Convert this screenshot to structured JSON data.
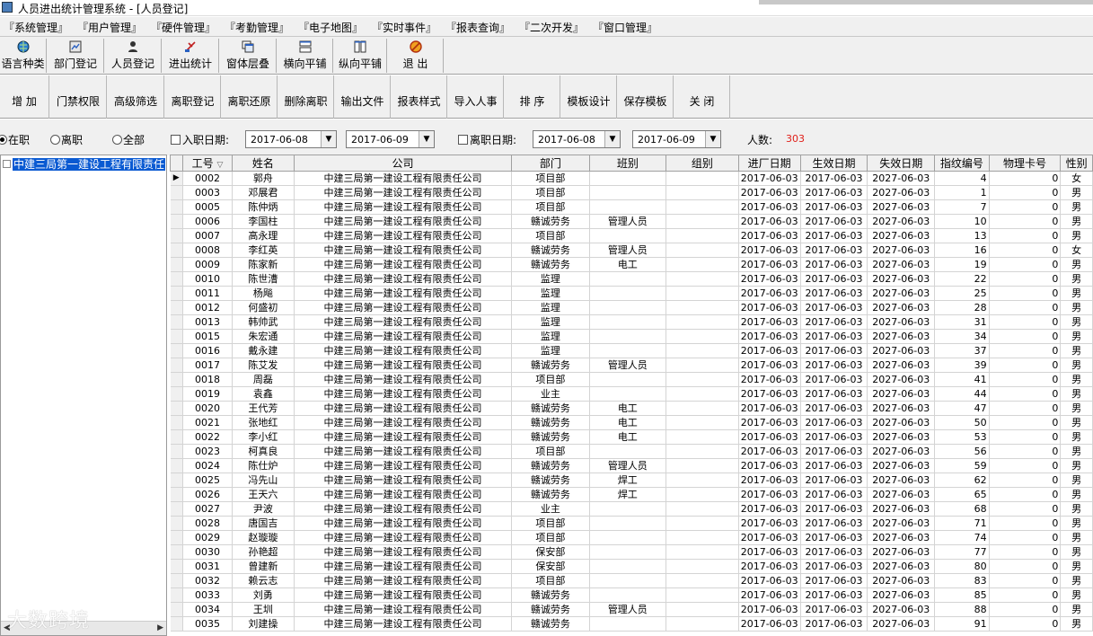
{
  "window": {
    "title": "人员进出统计管理系统 - [人员登记]"
  },
  "menu": [
    "『系统管理』",
    "『用户管理』",
    "『硬件管理』",
    "『考勤管理』",
    "『电子地图』",
    "『实时事件』",
    "『报表查询』",
    "『二次开发』",
    "『窗口管理』"
  ],
  "toolbar1": [
    {
      "label": "语言种类",
      "icon": "globe-icon"
    },
    {
      "label": "部门登记",
      "icon": "department-icon"
    },
    {
      "label": "人员登记",
      "icon": "person-icon"
    },
    {
      "label": "进出统计",
      "icon": "statistics-icon"
    },
    {
      "label": "窗体层叠",
      "icon": "cascade-windows-icon"
    },
    {
      "label": "横向平铺",
      "icon": "tile-horizontal-icon"
    },
    {
      "label": "纵向平铺",
      "icon": "tile-vertical-icon"
    },
    {
      "label": "退 出",
      "icon": "exit-icon"
    }
  ],
  "toolbar2": [
    "增  加",
    "门禁权限",
    "高级筛选",
    "离职登记",
    "离职还原",
    "删除离职",
    "输出文件",
    "报表样式",
    "导入人事",
    "排  序",
    "模板设计",
    "保存模板",
    "关  闭"
  ],
  "filter": {
    "radios": [
      {
        "label": "在职",
        "selected": true
      },
      {
        "label": "离职",
        "selected": false
      },
      {
        "label": "全部",
        "selected": false
      }
    ],
    "hire_date_label": "入职日期:",
    "hire_from": "2017-06-08",
    "hire_to": "2017-06-09",
    "leave_date_label": "离职日期:",
    "leave_from": "2017-06-08",
    "leave_to": "2017-06-09",
    "count_label": "人数:",
    "count_value": "303",
    "count_color": "#e0201a"
  },
  "tree": {
    "root_label": "中建三局第一建设工程有限责任"
  },
  "watermark": "大数跨境",
  "grid": {
    "columns": [
      "工号",
      "姓名",
      "公司",
      "部门",
      "班别",
      "组别",
      "进厂日期",
      "生效日期",
      "失效日期",
      "指纹编号",
      "物理卡号",
      "性别"
    ],
    "sort_indicator": "▽",
    "current_row_marker": "▶",
    "rows": [
      [
        "0002",
        "郭舟",
        "中建三局第一建设工程有限责任公司",
        "项目部",
        "",
        "",
        "2017-06-03",
        "2017-06-03",
        "2027-06-03",
        "4",
        "0",
        "女"
      ],
      [
        "0003",
        "邓展君",
        "中建三局第一建设工程有限责任公司",
        "项目部",
        "",
        "",
        "2017-06-03",
        "2017-06-03",
        "2027-06-03",
        "1",
        "0",
        "男"
      ],
      [
        "0005",
        "陈仲炳",
        "中建三局第一建设工程有限责任公司",
        "项目部",
        "",
        "",
        "2017-06-03",
        "2017-06-03",
        "2027-06-03",
        "7",
        "0",
        "男"
      ],
      [
        "0006",
        "李国柱",
        "中建三局第一建设工程有限责任公司",
        "赣诚劳务",
        "管理人员",
        "",
        "2017-06-03",
        "2017-06-03",
        "2027-06-03",
        "10",
        "0",
        "男"
      ],
      [
        "0007",
        "高永理",
        "中建三局第一建设工程有限责任公司",
        "项目部",
        "",
        "",
        "2017-06-03",
        "2017-06-03",
        "2027-06-03",
        "13",
        "0",
        "男"
      ],
      [
        "0008",
        "李红英",
        "中建三局第一建设工程有限责任公司",
        "赣诚劳务",
        "管理人员",
        "",
        "2017-06-03",
        "2017-06-03",
        "2027-06-03",
        "16",
        "0",
        "女"
      ],
      [
        "0009",
        "陈家新",
        "中建三局第一建设工程有限责任公司",
        "赣诚劳务",
        "电工",
        "",
        "2017-06-03",
        "2017-06-03",
        "2027-06-03",
        "19",
        "0",
        "男"
      ],
      [
        "0010",
        "陈世漕",
        "中建三局第一建设工程有限责任公司",
        "监理",
        "",
        "",
        "2017-06-03",
        "2017-06-03",
        "2027-06-03",
        "22",
        "0",
        "男"
      ],
      [
        "0011",
        "杨飚",
        "中建三局第一建设工程有限责任公司",
        "监理",
        "",
        "",
        "2017-06-03",
        "2017-06-03",
        "2027-06-03",
        "25",
        "0",
        "男"
      ],
      [
        "0012",
        "何盛初",
        "中建三局第一建设工程有限责任公司",
        "监理",
        "",
        "",
        "2017-06-03",
        "2017-06-03",
        "2027-06-03",
        "28",
        "0",
        "男"
      ],
      [
        "0013",
        "韩帅武",
        "中建三局第一建设工程有限责任公司",
        "监理",
        "",
        "",
        "2017-06-03",
        "2017-06-03",
        "2027-06-03",
        "31",
        "0",
        "男"
      ],
      [
        "0015",
        "朱宏通",
        "中建三局第一建设工程有限责任公司",
        "监理",
        "",
        "",
        "2017-06-03",
        "2017-06-03",
        "2027-06-03",
        "34",
        "0",
        "男"
      ],
      [
        "0016",
        "戴永建",
        "中建三局第一建设工程有限责任公司",
        "监理",
        "",
        "",
        "2017-06-03",
        "2017-06-03",
        "2027-06-03",
        "37",
        "0",
        "男"
      ],
      [
        "0017",
        "陈艾发",
        "中建三局第一建设工程有限责任公司",
        "赣诚劳务",
        "管理人员",
        "",
        "2017-06-03",
        "2017-06-03",
        "2027-06-03",
        "39",
        "0",
        "男"
      ],
      [
        "0018",
        "周磊",
        "中建三局第一建设工程有限责任公司",
        "项目部",
        "",
        "",
        "2017-06-03",
        "2017-06-03",
        "2027-06-03",
        "41",
        "0",
        "男"
      ],
      [
        "0019",
        "袁鑫",
        "中建三局第一建设工程有限责任公司",
        "业主",
        "",
        "",
        "2017-06-03",
        "2017-06-03",
        "2027-06-03",
        "44",
        "0",
        "男"
      ],
      [
        "0020",
        "王代芳",
        "中建三局第一建设工程有限责任公司",
        "赣诚劳务",
        "电工",
        "",
        "2017-06-03",
        "2017-06-03",
        "2027-06-03",
        "47",
        "0",
        "男"
      ],
      [
        "0021",
        "张地红",
        "中建三局第一建设工程有限责任公司",
        "赣诚劳务",
        "电工",
        "",
        "2017-06-03",
        "2017-06-03",
        "2027-06-03",
        "50",
        "0",
        "男"
      ],
      [
        "0022",
        "李小红",
        "中建三局第一建设工程有限责任公司",
        "赣诚劳务",
        "电工",
        "",
        "2017-06-03",
        "2017-06-03",
        "2027-06-03",
        "53",
        "0",
        "男"
      ],
      [
        "0023",
        "柯真良",
        "中建三局第一建设工程有限责任公司",
        "项目部",
        "",
        "",
        "2017-06-03",
        "2017-06-03",
        "2027-06-03",
        "56",
        "0",
        "男"
      ],
      [
        "0024",
        "陈仕炉",
        "中建三局第一建设工程有限责任公司",
        "赣诚劳务",
        "管理人员",
        "",
        "2017-06-03",
        "2017-06-03",
        "2027-06-03",
        "59",
        "0",
        "男"
      ],
      [
        "0025",
        "冯先山",
        "中建三局第一建设工程有限责任公司",
        "赣诚劳务",
        "焊工",
        "",
        "2017-06-03",
        "2017-06-03",
        "2027-06-03",
        "62",
        "0",
        "男"
      ],
      [
        "0026",
        "王天六",
        "中建三局第一建设工程有限责任公司",
        "赣诚劳务",
        "焊工",
        "",
        "2017-06-03",
        "2017-06-03",
        "2027-06-03",
        "65",
        "0",
        "男"
      ],
      [
        "0027",
        "尹波",
        "中建三局第一建设工程有限责任公司",
        "业主",
        "",
        "",
        "2017-06-03",
        "2017-06-03",
        "2027-06-03",
        "68",
        "0",
        "男"
      ],
      [
        "0028",
        "唐国吉",
        "中建三局第一建设工程有限责任公司",
        "项目部",
        "",
        "",
        "2017-06-03",
        "2017-06-03",
        "2027-06-03",
        "71",
        "0",
        "男"
      ],
      [
        "0029",
        "赵璇璇",
        "中建三局第一建设工程有限责任公司",
        "项目部",
        "",
        "",
        "2017-06-03",
        "2017-06-03",
        "2027-06-03",
        "74",
        "0",
        "男"
      ],
      [
        "0030",
        "孙艳超",
        "中建三局第一建设工程有限责任公司",
        "保安部",
        "",
        "",
        "2017-06-03",
        "2017-06-03",
        "2027-06-03",
        "77",
        "0",
        "男"
      ],
      [
        "0031",
        "曾建新",
        "中建三局第一建设工程有限责任公司",
        "保安部",
        "",
        "",
        "2017-06-03",
        "2017-06-03",
        "2027-06-03",
        "80",
        "0",
        "男"
      ],
      [
        "0032",
        "赖云志",
        "中建三局第一建设工程有限责任公司",
        "项目部",
        "",
        "",
        "2017-06-03",
        "2017-06-03",
        "2027-06-03",
        "83",
        "0",
        "男"
      ],
      [
        "0033",
        "刘勇",
        "中建三局第一建设工程有限责任公司",
        "赣诚劳务",
        "",
        "",
        "2017-06-03",
        "2017-06-03",
        "2027-06-03",
        "85",
        "0",
        "男"
      ],
      [
        "0034",
        "王圳",
        "中建三局第一建设工程有限责任公司",
        "赣诚劳务",
        "管理人员",
        "",
        "2017-06-03",
        "2017-06-03",
        "2027-06-03",
        "88",
        "0",
        "男"
      ],
      [
        "0035",
        "刘建操",
        "中建三局第一建设工程有限责任公司",
        "赣诚劳务",
        "",
        "",
        "2017-06-03",
        "2017-06-03",
        "2027-06-03",
        "91",
        "0",
        "男"
      ]
    ]
  }
}
